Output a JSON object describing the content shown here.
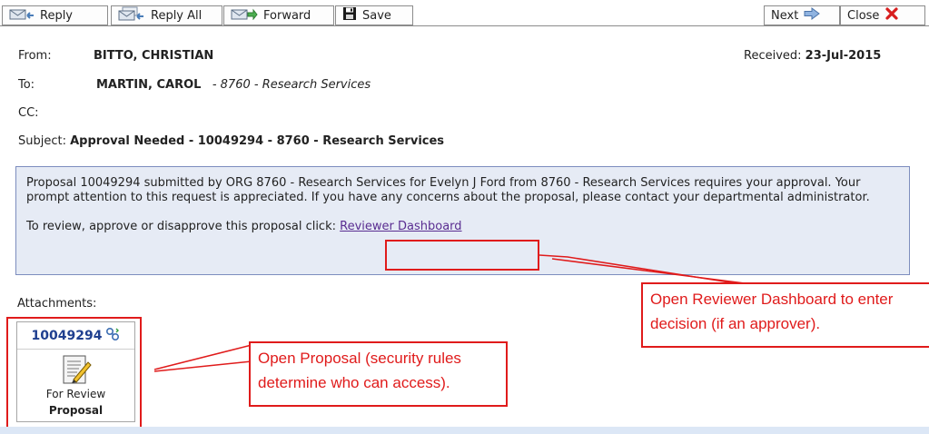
{
  "toolbar": {
    "reply": "Reply",
    "reply_all": "Reply All",
    "forward": "Forward",
    "save": "Save",
    "next": "Next",
    "close": "Close"
  },
  "header": {
    "from_label": "From:",
    "from_value": "BITTO, CHRISTIAN",
    "received_label": "Received:",
    "received_value": "23-Jul-2015",
    "to_label": "To:",
    "to_name": "MARTIN, CAROL",
    "to_org": "- 8760 - Research Services",
    "cc_label": "CC:",
    "subject_label": "Subject:",
    "subject_value": "Approval Needed - 10049294 - 8760 - Research Services"
  },
  "message": {
    "body": "Proposal 10049294 submitted by ORG 8760 - Research Services for Evelyn J Ford from 8760 - Research Services requires your approval. Your prompt attention to this request is appreciated. If you have any concerns about the proposal, please contact your departmental administrator.",
    "review_prompt": "To review, approve or disapprove this proposal click:",
    "link_text": "Reviewer Dashboard"
  },
  "attachments": {
    "label": "Attachments:",
    "item": {
      "number": "10049294",
      "status": "For Review",
      "type": "Proposal"
    }
  },
  "annotations": {
    "dashboard_note": "Open Reviewer Dashboard to enter decision (if an approver).",
    "proposal_note": "Open Proposal (security rules determine who can access)."
  },
  "colors": {
    "annotation_red": "#e01b1b",
    "message_bg": "#e6ebf5",
    "link": "#5a2d91",
    "attachment_number": "#1f3f8f"
  }
}
